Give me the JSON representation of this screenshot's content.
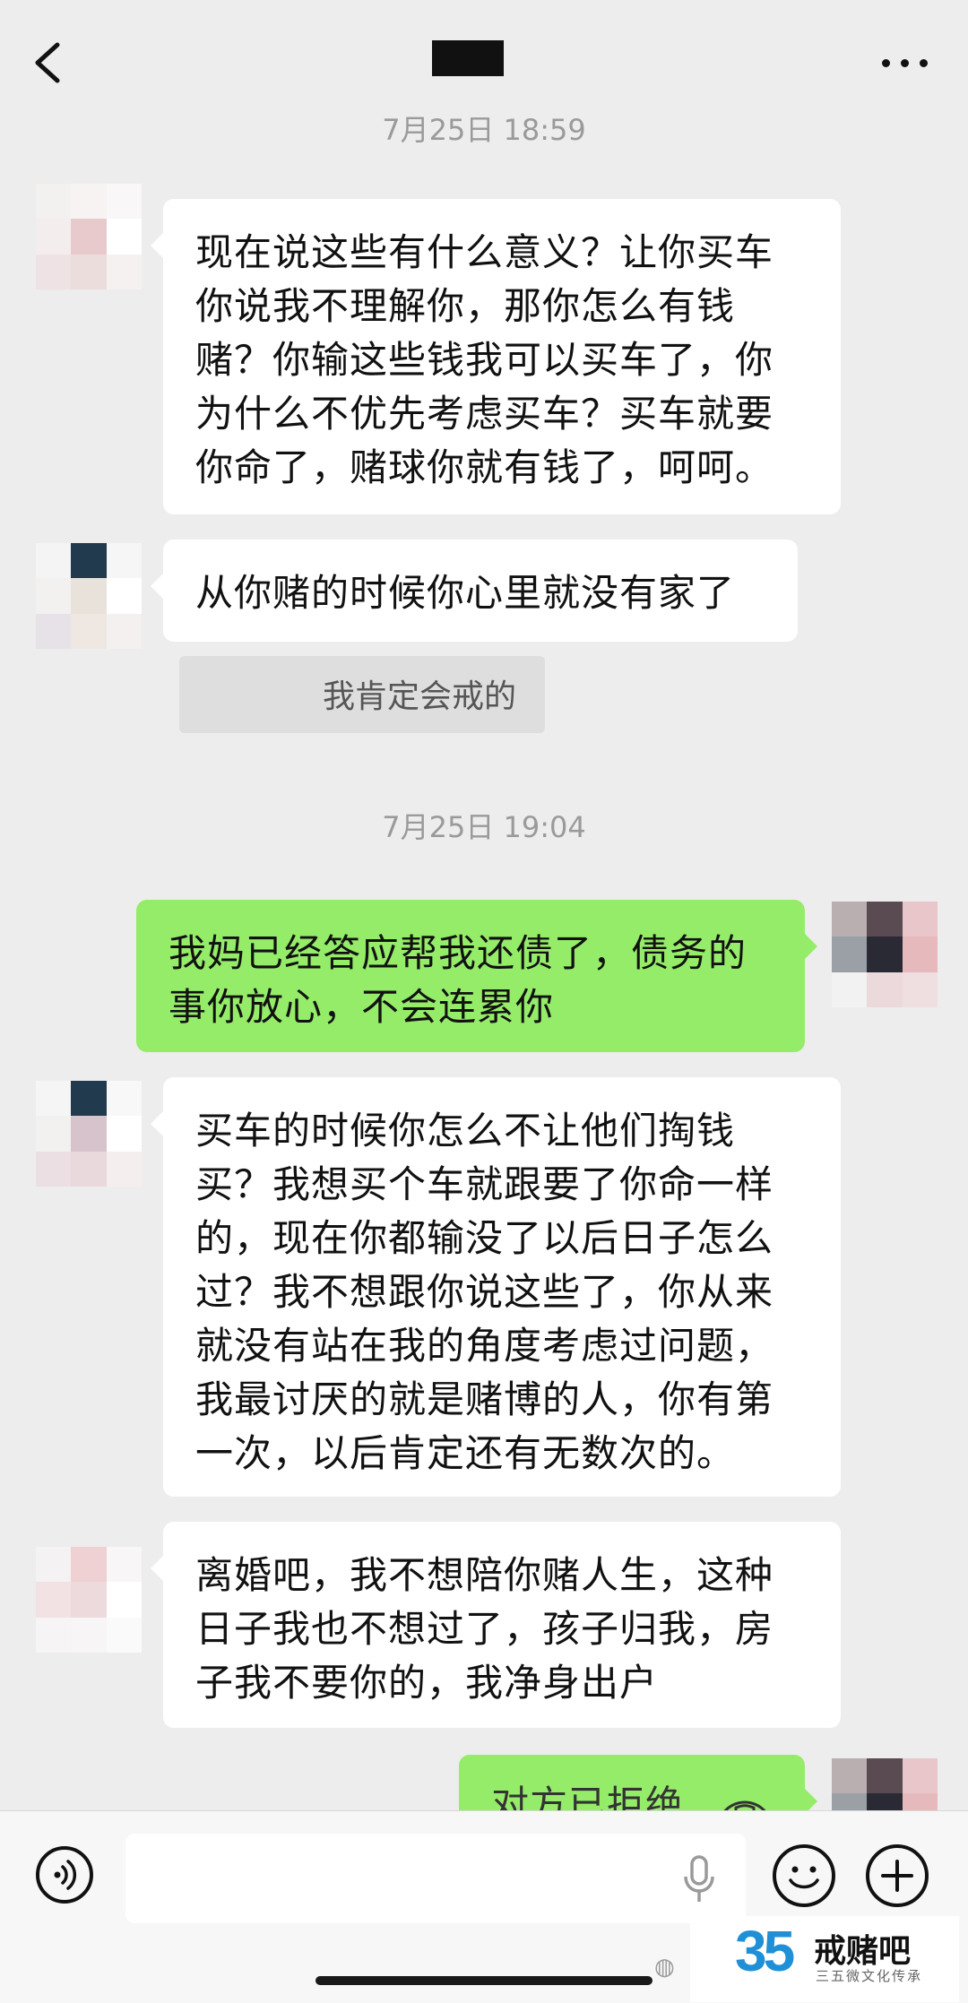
{
  "header": {
    "back_icon": "chevron-left-icon",
    "contact_name": "",
    "more_icon": "more-horizontal-icon"
  },
  "messages": [
    {
      "type": "timestamp",
      "text": "7月25日 18:59"
    },
    {
      "type": "in",
      "lines": [
        "现在说这些有什么意义？让你买车",
        "你说我不理解你，那你怎么有钱",
        "赌？你输这些钱我可以买车了，你",
        "为什么不优先考虑买车？买车就要",
        "你命了，赌球你就有钱了，呵呵。"
      ]
    },
    {
      "type": "in",
      "lines": [
        "从你赌的时候你心里就没有家了"
      ]
    },
    {
      "type": "out-gray",
      "text": "我肯定会戒的"
    },
    {
      "type": "timestamp",
      "text": "7月25日 19:04"
    },
    {
      "type": "out",
      "lines": [
        "我妈已经答应帮我还债了，债务的",
        "事你放心，不会连累你"
      ]
    },
    {
      "type": "in",
      "lines": [
        "买车的时候你怎么不让他们掏钱",
        "买？我想买个车就跟要了你命一样",
        "的，现在你都输没了以后日子怎么",
        "过？我不想跟你说这些了，你从来",
        "就没有站在我的角度考虑过问题，",
        "我最讨厌的就是赌博的人，你有第",
        "一次，以后肯定还有无数次的。"
      ]
    },
    {
      "type": "in",
      "lines": [
        "离婚吧，我不想陪你赌人生，这种",
        "日子我也不想过了，孩子归我，房",
        "子我不要你的，我净身出户"
      ]
    },
    {
      "type": "out-call",
      "text": "对方已拒绝"
    }
  ],
  "input_bar": {
    "voice_icon": "voice-icon",
    "mic_icon": "microphone-icon",
    "emoji_icon": "emoji-icon",
    "plus_icon": "plus-icon"
  },
  "watermark": {
    "logo_number": "35",
    "title": "戒赌吧",
    "subtitle": "三五微文化传承"
  },
  "colors": {
    "background": "#ededed",
    "incoming_bubble": "#ffffff",
    "outgoing_bubble": "#95ec69",
    "timestamp_text": "#9a9a9a"
  }
}
